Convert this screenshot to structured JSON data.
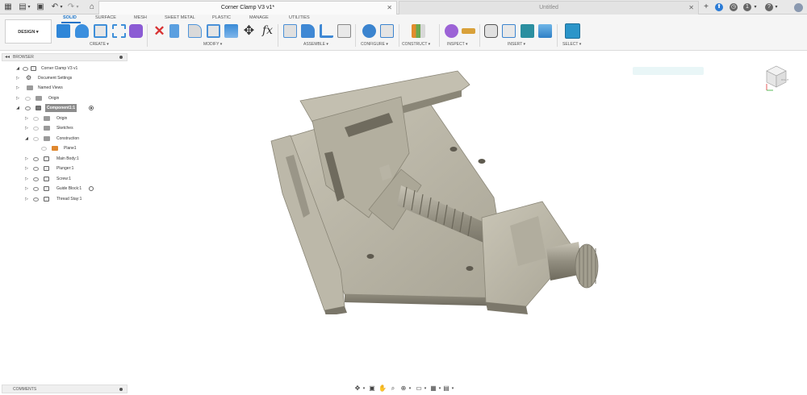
{
  "document": {
    "active_tab_title": "Corner Clamp V3 v1*",
    "inactive_tab_title": "Untitled"
  },
  "workspace": {
    "button_label": "DESIGN",
    "tabs": [
      "SOLID",
      "SURFACE",
      "MESH",
      "SHEET METAL",
      "PLASTIC",
      "MANAGE",
      "UTILITIES"
    ],
    "active_tab": "SOLID"
  },
  "ribbon_groups": [
    {
      "label": "CREATE ▾"
    },
    {
      "label": "MODIFY ▾"
    },
    {
      "label": "ASSEMBLE ▾"
    },
    {
      "label": "CONFIGURE ▾"
    },
    {
      "label": "CONSTRUCT ▾"
    },
    {
      "label": "INSPECT ▾"
    },
    {
      "label": "INSERT ▾"
    },
    {
      "label": "SELECT ▾"
    }
  ],
  "browser": {
    "title": "BROWSER",
    "root": "Corner Clamp V3 v1",
    "items": [
      {
        "label": "Document Settings"
      },
      {
        "label": "Named Views"
      },
      {
        "label": "Origin"
      },
      {
        "label": "Component1:1"
      },
      {
        "label": "Origin"
      },
      {
        "label": "Sketches"
      },
      {
        "label": "Construction"
      },
      {
        "label": "Plane1"
      },
      {
        "label": "Main Body:1"
      },
      {
        "label": "Plunger:1"
      },
      {
        "label": "Screw:1"
      },
      {
        "label": "Guide Block:1"
      },
      {
        "label": "Thread Stay:1"
      }
    ]
  },
  "comments": {
    "title": "COMMENTS"
  },
  "viewcube": {
    "face_label": "RIGHT"
  },
  "colors": {
    "accent": "#1a73c7",
    "model_base": "#a9a596",
    "model_light": "#d4d0c4",
    "model_dark": "#7f7b6d"
  }
}
